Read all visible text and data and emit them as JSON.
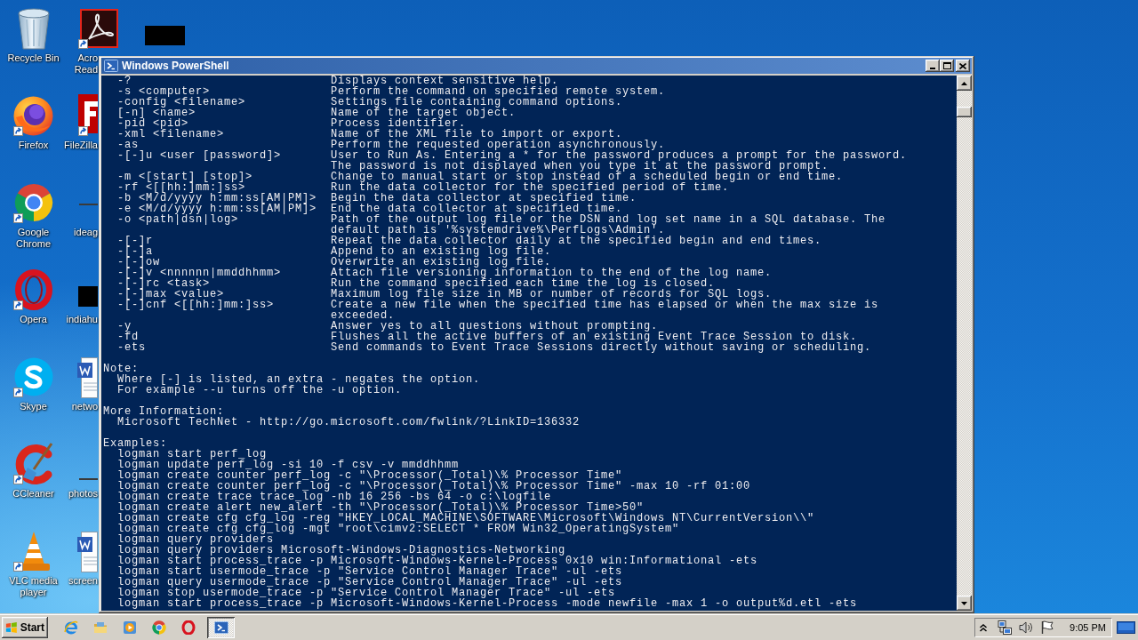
{
  "desktop_icons": [
    {
      "label": "Recycle Bin",
      "shortcut": false
    },
    {
      "label": "Firefox",
      "shortcut": true
    },
    {
      "label": "Google Chrome",
      "shortcut": true
    },
    {
      "label": "Opera",
      "shortcut": true
    },
    {
      "label": "Skype",
      "shortcut": true
    },
    {
      "label": "CCleaner",
      "shortcut": true
    },
    {
      "label": "VLC media player",
      "shortcut": true
    },
    {
      "label": "Acro Read",
      "shortcut": true
    },
    {
      "label": "FileZilla",
      "shortcut": true
    },
    {
      "label": "ideag",
      "shortcut": false
    },
    {
      "label": "indiahu",
      "shortcut": false
    },
    {
      "label": "netwo",
      "shortcut": false
    },
    {
      "label": "photos",
      "shortcut": false
    },
    {
      "label": "screen",
      "shortcut": false
    }
  ],
  "window": {
    "title": "Windows PowerShell",
    "console": {
      "options": [
        {
          "flag": "-?",
          "description": [
            "Displays context sensitive help."
          ]
        },
        {
          "flag": "-s <computer>",
          "description": [
            "Perform the command on specified remote system."
          ]
        },
        {
          "flag": "-config <filename>",
          "description": [
            "Settings file containing command options."
          ]
        },
        {
          "flag": "[-n] <name>",
          "description": [
            "Name of the target object."
          ]
        },
        {
          "flag": "-pid <pid>",
          "description": [
            "Process identifier."
          ]
        },
        {
          "flag": "-xml <filename>",
          "description": [
            "Name of the XML file to import or export."
          ]
        },
        {
          "flag": "-as",
          "description": [
            "Perform the requested operation asynchronously."
          ]
        },
        {
          "flag": "-[-]u <user [password]>",
          "description": [
            "User to Run As. Entering a * for the password produces a prompt for the password.",
            "The password is not displayed when you type it at the password prompt."
          ]
        },
        {
          "flag": "-m <[start] [stop]>",
          "description": [
            "Change to manual start or stop instead of a scheduled begin or end time."
          ]
        },
        {
          "flag": "-rf <[[hh:]mm:]ss>",
          "description": [
            "Run the data collector for the specified period of time."
          ]
        },
        {
          "flag": "-b <M/d/yyyy h:mm:ss[AM|PM]>",
          "description": [
            "Begin the data collector at specified time."
          ]
        },
        {
          "flag": "-e <M/d/yyyy h:mm:ss[AM|PM]>",
          "description": [
            "End the data collector at specified time."
          ]
        },
        {
          "flag": "-o <path|dsn|log>",
          "description": [
            "Path of the output log file or the DSN and log set name in a SQL database. The",
            "default path is '%systemdrive%\\PerfLogs\\Admin'."
          ]
        },
        {
          "flag": "-[-]r",
          "description": [
            "Repeat the data collector daily at the specified begin and end times."
          ]
        },
        {
          "flag": "-[-]a",
          "description": [
            "Append to an existing log file."
          ]
        },
        {
          "flag": "-[-]ow",
          "description": [
            "Overwrite an existing log file."
          ]
        },
        {
          "flag": "-[-]v <nnnnnn|mmddhhmm>",
          "description": [
            "Attach file versioning information to the end of the log name."
          ]
        },
        {
          "flag": "-[-]rc <task>",
          "description": [
            "Run the command specified each time the log is closed."
          ]
        },
        {
          "flag": "-[-]max <value>",
          "description": [
            "Maximum log file size in MB or number of records for SQL logs."
          ]
        },
        {
          "flag": "-[-]cnf <[[hh:]mm:]ss>",
          "description": [
            "Create a new file when the specified time has elapsed or when the max size is",
            "exceeded."
          ]
        },
        {
          "flag": "-y",
          "description": [
            "Answer yes to all questions without prompting."
          ]
        },
        {
          "flag": "-fd",
          "description": [
            "Flushes all the active buffers of an existing Event Trace Session to disk."
          ]
        },
        {
          "flag": "-ets",
          "description": [
            "Send commands to Event Trace Sessions directly without saving or scheduling."
          ]
        }
      ],
      "sections": [
        {
          "heading": "Note:",
          "lines": [
            "Where [-] is listed, an extra - negates the option.",
            "For example --u turns off the -u option."
          ]
        },
        {
          "heading": "More Information:",
          "lines": [
            "Microsoft TechNet - http://go.microsoft.com/fwlink/?LinkID=136332"
          ]
        },
        {
          "heading": "Examples:",
          "lines": [
            "logman start perf_log",
            "logman update perf_log -si 10 -f csv -v mmddhhmm",
            "logman create counter perf_log -c \"\\Processor(_Total)\\% Processor Time\"",
            "logman create counter perf_log -c \"\\Processor(_Total)\\% Processor Time\" -max 10 -rf 01:00",
            "logman create trace trace_log -nb 16 256 -bs 64 -o c:\\logfile",
            "logman create alert new_alert -th \"\\Processor(_Total)\\% Processor Time>50\"",
            "logman create cfg cfg_log -reg \"HKEY_LOCAL_MACHINE\\SOFTWARE\\Microsoft\\Windows NT\\CurrentVersion\\\\\"",
            "logman create cfg cfg_log -mgt \"root\\cimv2:SELECT * FROM Win32_OperatingSystem\"",
            "logman query providers",
            "logman query providers Microsoft-Windows-Diagnostics-Networking",
            "logman start process_trace -p Microsoft-Windows-Kernel-Process 0x10 win:Informational -ets",
            "logman start usermode_trace -p \"Service Control Manager Trace\" -ul -ets",
            "logman query usermode_trace -p \"Service Control Manager Trace\" -ul -ets",
            "logman stop usermode_trace -p \"Service Control Manager Trace\" -ul -ets",
            "logman start process_trace -p Microsoft-Windows-Kernel-Process -mode newfile -max 1 -o output%d.etl -ets"
          ]
        }
      ]
    }
  },
  "taskbar": {
    "start_label": "Start",
    "tasks": [
      {
        "selected": true
      }
    ],
    "clock": "9:05 PM"
  }
}
